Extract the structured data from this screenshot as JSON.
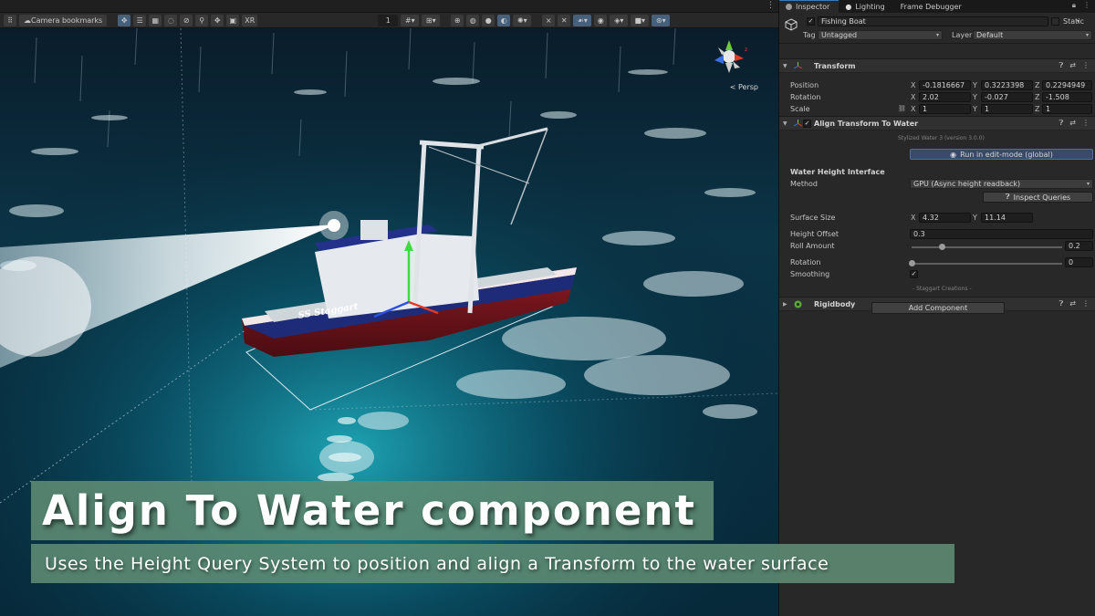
{
  "scene": {
    "toolbar": {
      "camera_bookmarks_label": "Camera bookmarks",
      "grid_count": "1",
      "xr_label": "XR",
      "buttons": [
        "move-tool-icon",
        "rect-tool-icon",
        "grid-snap-icon",
        "rotate-icon",
        "scale-icon",
        "search-icon",
        "transform-icon",
        "pivot-icon"
      ]
    },
    "persp_label": "< Persp",
    "boat_name": "SS Staggart",
    "title": "Align To Water component",
    "subtitle": "Uses the Height Query System to position and align a Transform to the water surface"
  },
  "inspector": {
    "tabs": [
      {
        "label": "Inspector",
        "icon": "info-icon",
        "active": true
      },
      {
        "label": "Lighting",
        "icon": "bulb-icon",
        "active": false
      },
      {
        "label": "Frame Debugger",
        "icon": "",
        "active": false
      }
    ],
    "object": {
      "name": "Fishing Boat",
      "enabled": true,
      "static_label": "Static",
      "tag_label": "Tag",
      "tag_value": "Untagged",
      "layer_label": "Layer",
      "layer_value": "Default"
    },
    "transform": {
      "title": "Transform",
      "position_label": "Position",
      "position": {
        "x": "-0.1816667",
        "y": "0.3223398",
        "z": "0.2294949"
      },
      "rotation_label": "Rotation",
      "rotation": {
        "x": "2.02",
        "y": "-0.027",
        "z": "-1.508"
      },
      "scale_label": "Scale",
      "scale": {
        "x": "1",
        "y": "1",
        "z": "1"
      }
    },
    "align": {
      "title": "Align Transform To Water",
      "version": "Stylized Water 3 (version 3.0.0)",
      "run_button": "Run in edit-mode (global)",
      "section_label": "Water Height Interface",
      "method_label": "Method",
      "method_value": "GPU (Async height readback)",
      "inspect_button": "Inspect Queries",
      "surface_size_label": "Surface Size",
      "surface_size": {
        "x": "4.32",
        "y": "11.14"
      },
      "height_offset_label": "Height Offset",
      "height_offset": "0.3",
      "roll_amount_label": "Roll Amount",
      "roll_amount": "0.2",
      "roll_fraction": 0.2,
      "rotation_label": "Rotation",
      "rotation_value": "0",
      "rotation_fraction": 0,
      "smoothing_label": "Smoothing",
      "smoothing": true,
      "credits": "- Staggart Creations -"
    },
    "rigidbody": {
      "title": "Rigidbody"
    },
    "add_component": "Add Component",
    "axis_labels": {
      "x": "X",
      "y": "Y",
      "z": "Z"
    },
    "colors": {
      "accent": "#3a79bb",
      "panel": "#282828",
      "header": "#303030"
    }
  }
}
